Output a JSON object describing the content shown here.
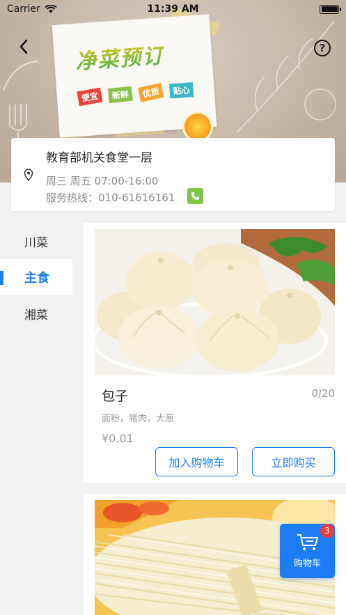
{
  "status_bar": {
    "carrier": "Carrier",
    "time": "11:39 AM"
  },
  "banner": {
    "title": "净菜预订",
    "tags": [
      {
        "label": "便宜",
        "color": "#e8453c"
      },
      {
        "label": "新鲜",
        "color": "#8cc04b"
      },
      {
        "label": "优质",
        "color": "#f2a531"
      },
      {
        "label": "贴心",
        "color": "#3bb7c8"
      }
    ]
  },
  "info": {
    "canteen_name": "教育部机关食堂一层",
    "hours": "周三 周五 07:00-16:00",
    "hotline": "服务热线：010-61616161"
  },
  "categories": [
    {
      "label": "川菜",
      "active": false
    },
    {
      "label": "主食",
      "active": true
    },
    {
      "label": "湘菜",
      "active": false
    }
  ],
  "foods": [
    {
      "name": "包子",
      "stock": "0/20",
      "ingredients": "面粉，猪肉，大葱",
      "price": "¥0.01",
      "add_label": "加入购物车",
      "buy_label": "立即购买"
    }
  ],
  "cart": {
    "label": "购物车",
    "count": "3"
  },
  "colors": {
    "accent": "#1c7cf4",
    "badge": "#f23b3b",
    "phone": "#7cc54a"
  }
}
